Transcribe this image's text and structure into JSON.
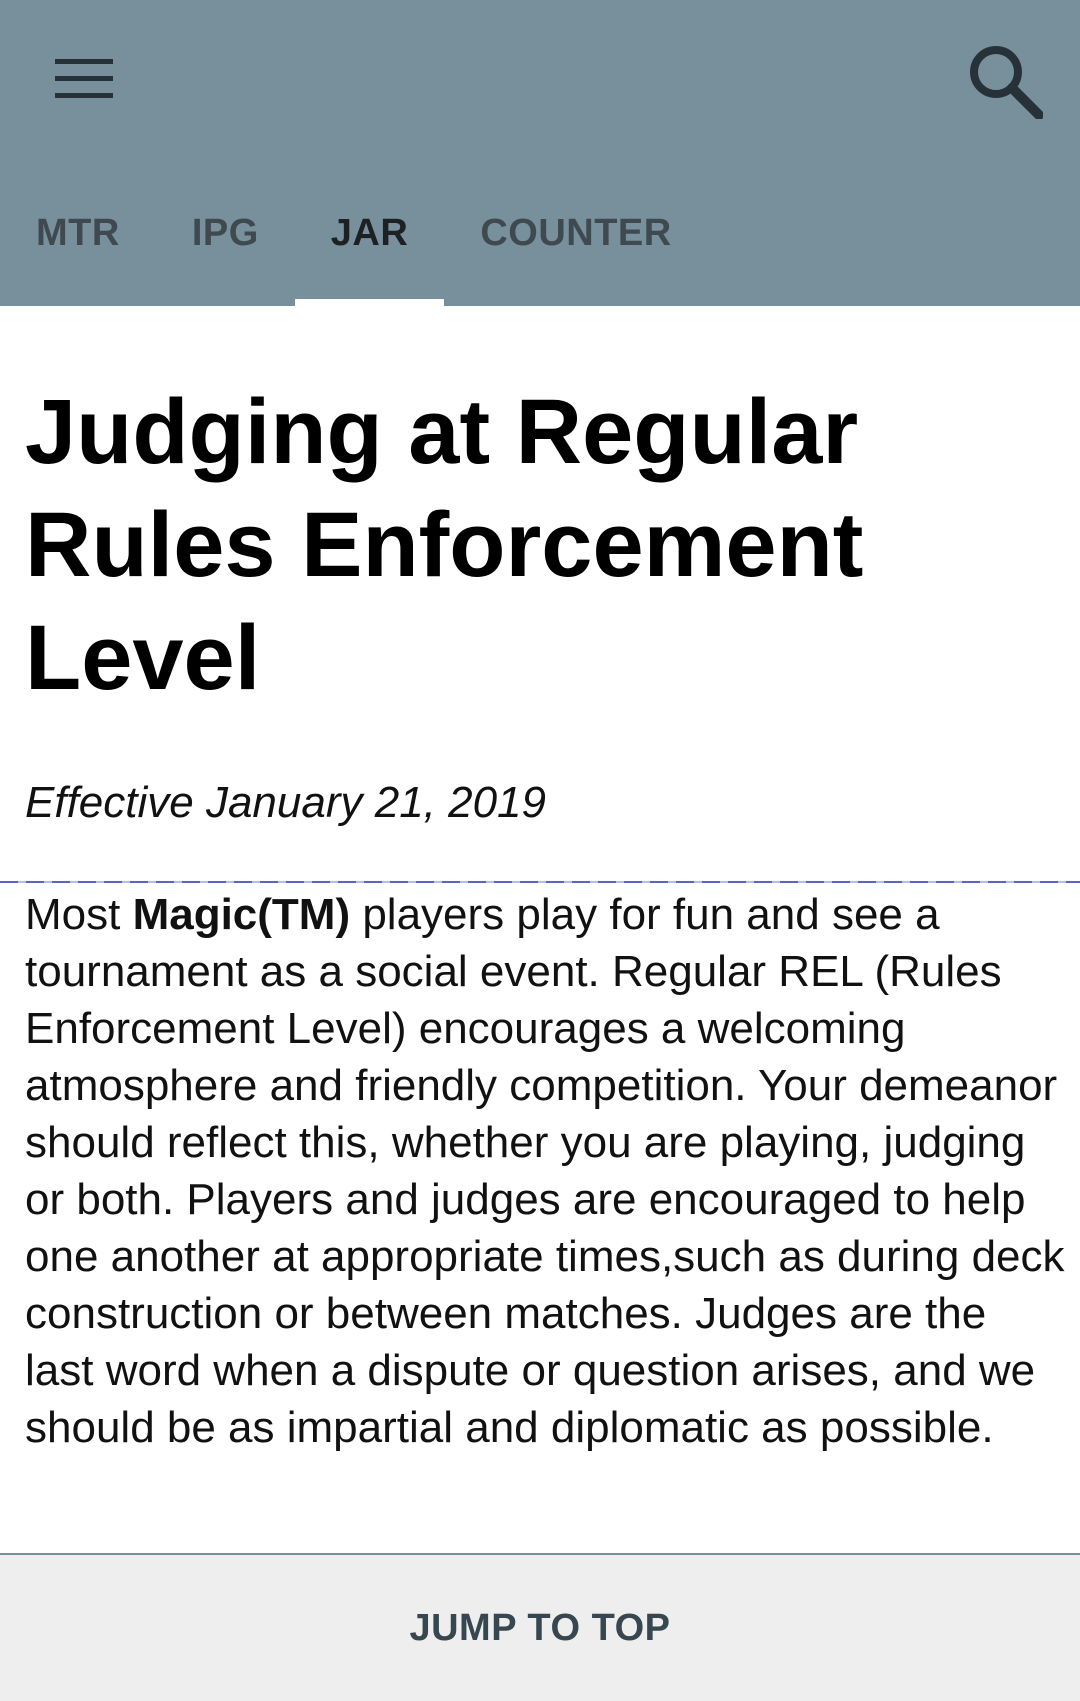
{
  "header": {
    "menu_icon": "hamburger-menu-icon",
    "search_icon": "search-icon",
    "colors": {
      "appbar": "#78909c",
      "indicator": "#ffffff"
    }
  },
  "tabs": [
    {
      "label": "MTR",
      "active": false
    },
    {
      "label": "IPG",
      "active": false
    },
    {
      "label": "JAR",
      "active": true
    },
    {
      "label": "COUNTER",
      "active": false
    }
  ],
  "document": {
    "title": "Judging at Regular Rules Enforcement Level",
    "effective": "Effective January 21, 2019",
    "intro_lead": "Most ",
    "intro_bold": "Magic(TM)",
    "intro_rest": " players play for fun and see a tournament as a social event. Regular REL (Rules Enforcement Level) encourages a welcoming atmosphere and friendly competition. Your demeanor should reflect this, whether you are playing, judging or both. Players and judges are encouraged to help one another at appropriate times,such as during deck construction or between matches. Judges are the last word when a dispute or question arises, and we should be as impartial and diplomatic as possible."
  },
  "footer": {
    "jump_label": "JUMP TO TOP"
  }
}
